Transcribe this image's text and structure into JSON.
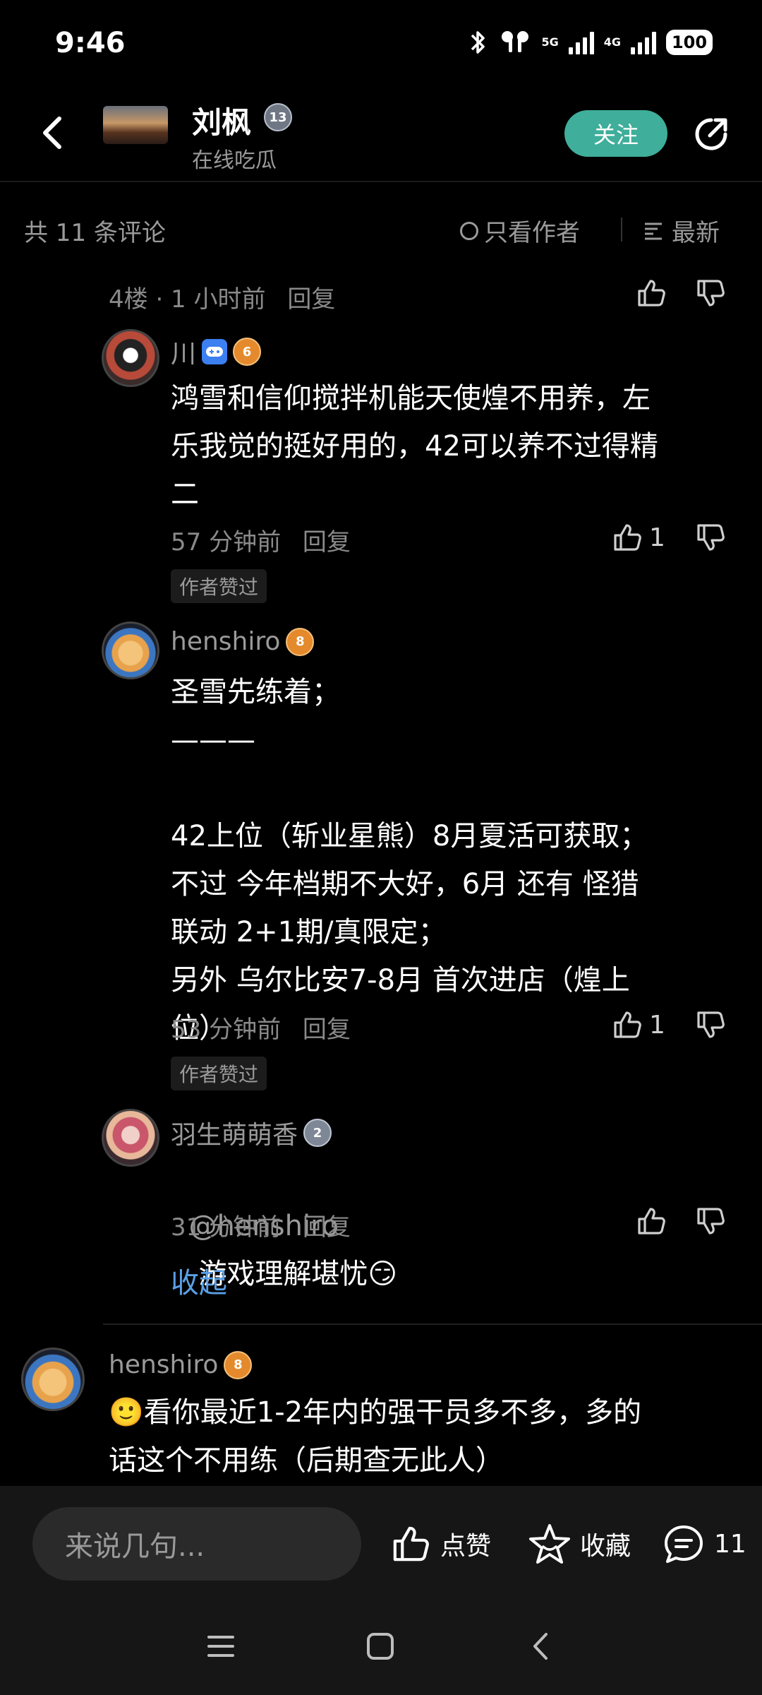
{
  "status": {
    "time": "9:46",
    "net1": "5G",
    "net2": "4G",
    "battery": "100"
  },
  "header": {
    "author_name": "刘枫",
    "author_level": "13",
    "author_subtitle": "在线吃瓜",
    "follow_label": "关注"
  },
  "filter": {
    "count_text": "共 11 条评论",
    "author_only": "只看作者",
    "sort": "最新"
  },
  "floor": {
    "label": "4楼 · 1 小时前",
    "reply": "回复"
  },
  "replies": [
    {
      "user": "川",
      "level": "6",
      "text": "鸿雪和信仰搅拌机能天使煌不用养，左\n乐我觉的挺好用的，42可以养不过得精\n二",
      "time": "57 分钟前",
      "reply": "回复",
      "likes": "1",
      "tag": "作者赞过"
    },
    {
      "user": "henshiro",
      "level": "8",
      "text": "圣雪先练着；\n———\n\n42上位（斩业星熊）8月夏活可获取；\n不过 今年档期不大好，6月 还有 怪猎\n联动 2+1期/真限定；\n另外 乌尔比安7-8月 首次进店（煌上\n位）",
      "time": "53 分钟前",
      "reply": "回复",
      "likes": "1",
      "tag": "作者赞过"
    },
    {
      "user": "羽生萌萌香",
      "level": "2",
      "mention": "@henshiro",
      "text": "游戏理解堪忧😏",
      "time": "31 分钟前",
      "reply": "回复"
    }
  ],
  "collapse": "收起",
  "next_comment": {
    "user": "henshiro",
    "level": "8",
    "text": "🙂看你最近1-2年内的强干员多不多，多的\n话这个不用练（后期查无此人）"
  },
  "bottom": {
    "input_placeholder": "来说几句...",
    "like_label": "点赞",
    "fav_label": "收藏",
    "comment_count": "11"
  }
}
